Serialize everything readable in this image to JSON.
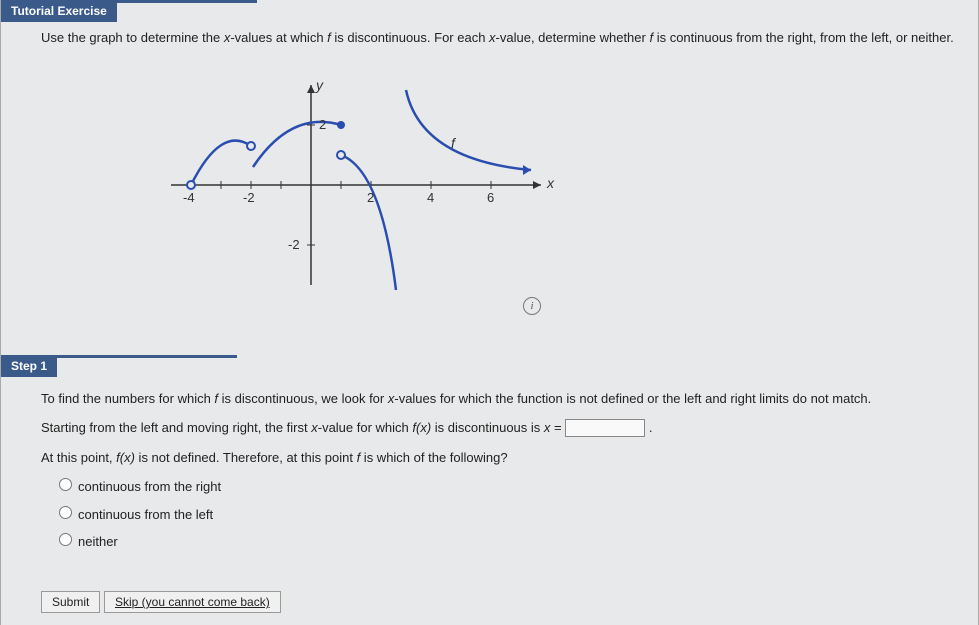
{
  "tutorial": {
    "header": "Tutorial Exercise",
    "instruction_pre": "Use the graph to determine the ",
    "instruction_xval": "x",
    "instruction_mid": "-values at which ",
    "instruction_f": "f",
    "instruction_mid2": " is discontinuous. For each ",
    "instruction_xval2": "x",
    "instruction_mid3": "-value, determine whether ",
    "instruction_f2": "f",
    "instruction_end": " is continuous from the right, from the left, or neither."
  },
  "chart_data": {
    "type": "line",
    "title": "",
    "xlabel": "x",
    "ylabel": "y",
    "function_label": "f",
    "xlim": [
      -5,
      7
    ],
    "ylim": [
      -3.5,
      3
    ],
    "xticks": [
      -4,
      -2,
      2,
      4,
      6
    ],
    "yticks": [
      -2,
      2
    ],
    "discontinuities": [
      {
        "x": -4,
        "type": "endpoint",
        "filled": false,
        "y": 0
      },
      {
        "x": -2,
        "type": "removable",
        "y_curve": 1.3,
        "y_point": null,
        "filled": false
      },
      {
        "x": 1,
        "type": "jump",
        "left_y": 2,
        "left_filled": true,
        "right_y": 1,
        "right_filled": false
      },
      {
        "x": 3,
        "type": "infinite",
        "asymptote": true
      }
    ],
    "segments": [
      {
        "from_x": -4,
        "to_x": -2,
        "description": "arc rising from open (-4,0) to open (-2,1.3) via (-3,1.8)",
        "open_start": true,
        "open_end": true
      },
      {
        "from_x": -2,
        "to_x": 1,
        "description": "arc from below (-2) up to closed (1,2)",
        "open_start": false,
        "open_end": false,
        "closed_end": true
      },
      {
        "from_x": 1,
        "to_x": 3,
        "description": "curve from open (1,1) descending to -infinity as x→3-",
        "open_start": true
      },
      {
        "from_x": 3,
        "to_x": 7,
        "description": "curve from +infinity at x→3+ descending toward y≈0.5 with arrow",
        "arrow_end": true
      }
    ]
  },
  "step1": {
    "header": "Step 1",
    "line1_pre": "To find the numbers for which ",
    "line1_f": "f",
    "line1_mid": " is discontinuous, we look for ",
    "line1_x": "x",
    "line1_end": "-values for which the function is not defined or the left and right limits do not match.",
    "line2_pre": "Starting from the left and moving right, the first ",
    "line2_x": "x",
    "line2_mid": "-value for which ",
    "line2_fx": "f(x)",
    "line2_mid2": " is discontinuous is ",
    "line2_x2": "x",
    "line2_eq": " = ",
    "line2_end": " .",
    "line3_pre": "At this point, ",
    "line3_fx": "f(x)",
    "line3_mid": " is not defined. Therefore, at this point ",
    "line3_f": "f",
    "line3_end": " is which of the following?",
    "options": [
      "continuous from the right",
      "continuous from the left",
      "neither"
    ],
    "input_value": ""
  },
  "buttons": {
    "submit": "Submit",
    "skip": "Skip (you cannot come back)"
  },
  "info_icon": "i"
}
